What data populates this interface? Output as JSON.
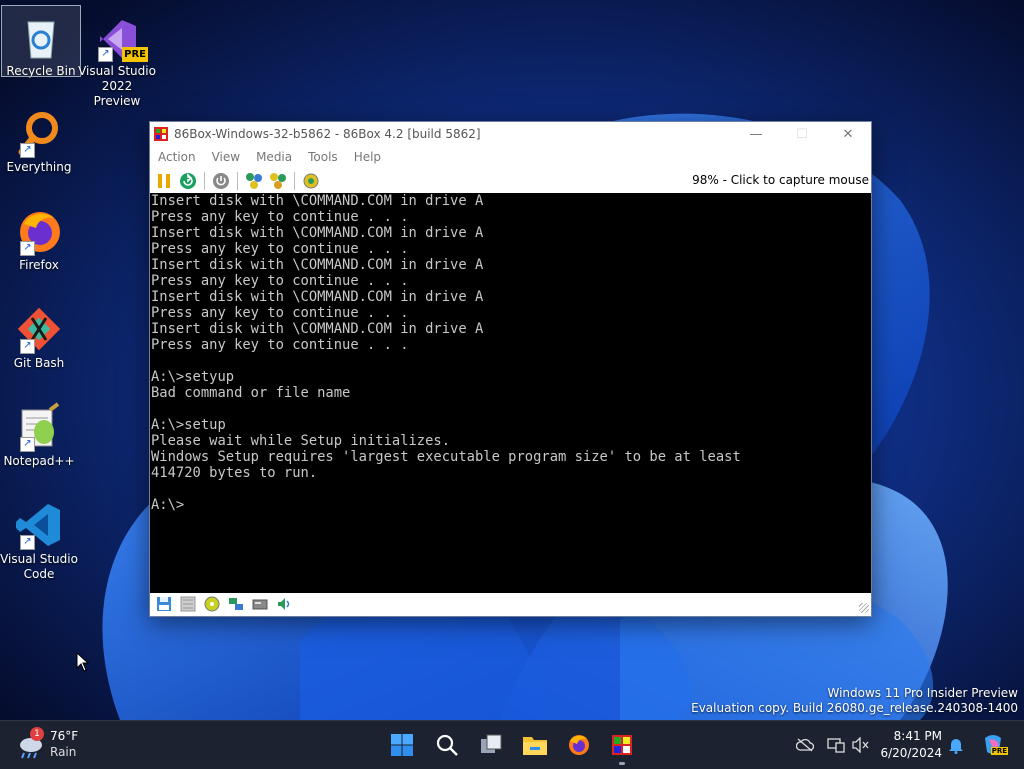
{
  "desktop": {
    "icons": [
      {
        "label": "Recycle Bin"
      },
      {
        "label": "Visual Studio 2022 Preview",
        "badge": "PRE"
      },
      {
        "label": "Everything"
      },
      {
        "label": "Firefox"
      },
      {
        "label": "Git Bash"
      },
      {
        "label": "Notepad++"
      },
      {
        "label": "Visual Studio Code"
      }
    ]
  },
  "vm_window": {
    "title": "86Box-Windows-32-b5862 - 86Box 4.2 [build 5862]",
    "menu": [
      "Action",
      "View",
      "Media",
      "Tools",
      "Help"
    ],
    "capture_text": "98% - Click to capture mouse",
    "console_lines": [
      "Insert disk with \\COMMAND.COM in drive A",
      "Press any key to continue . . .",
      "Insert disk with \\COMMAND.COM in drive A",
      "Press any key to continue . . .",
      "Insert disk with \\COMMAND.COM in drive A",
      "Press any key to continue . . .",
      "Insert disk with \\COMMAND.COM in drive A",
      "Press any key to continue . . .",
      "Insert disk with \\COMMAND.COM in drive A",
      "Press any key to continue . . .",
      "",
      "A:\\>setyup",
      "Bad command or file name",
      "",
      "A:\\>setup",
      "Please wait while Setup initializes.",
      "Windows Setup requires 'largest executable program size' to be at least",
      "414720 bytes to run.",
      "",
      "A:\\>"
    ]
  },
  "watermark": {
    "line1": "Windows 11 Pro Insider Preview",
    "line2": "Evaluation copy. Build 26080.ge_release.240308-1400"
  },
  "taskbar": {
    "weather": {
      "temp": "76°F",
      "condition": "Rain",
      "badge": "1"
    },
    "clock": {
      "time": "8:41 PM",
      "date": "6/20/2024"
    },
    "copilot_badge": "PRE"
  },
  "colors": {
    "console_text": "#c8c8c8",
    "console_bg": "#000000",
    "taskbar_bg": "#1d2230"
  }
}
